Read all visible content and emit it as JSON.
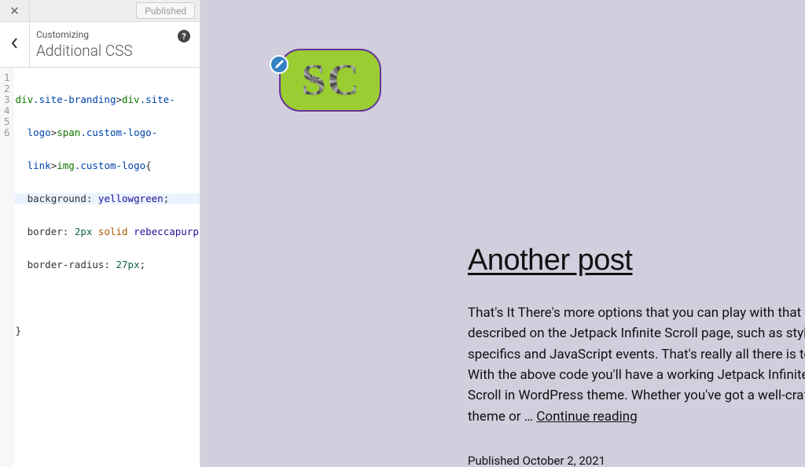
{
  "header": {
    "published_label": "Published"
  },
  "section": {
    "customizing_label": "Customizing",
    "title": "Additional CSS",
    "help_glyph": "?"
  },
  "code": {
    "line_numbers": [
      "1",
      "2",
      "3",
      "4",
      "5",
      "6"
    ],
    "l1_tag1": "div",
    "l1_qual1": ".site-branding",
    "l1_gt1": ">",
    "l1_tag2": "div",
    "l1_qual2": ".site-",
    "l1b_qual": "logo",
    "l1b_gt": ">",
    "l1b_tag": "span",
    "l1b_qual2": ".custom-logo-",
    "l1c_qual": "link",
    "l1c_gt": ">",
    "l1c_tag": "img",
    "l1c_qual2": ".custom-logo",
    "l1c_brace": "{",
    "l2_prop": "background",
    "l2_colon": ": ",
    "l2_val": "yellowgreen",
    "l2_semi": ";",
    "l3_prop": "border",
    "l3_colon": ": ",
    "l3_num": "2px",
    "l3_solid": " solid ",
    "l3_color": "rebeccapurple",
    "l3_semi": ";",
    "l4_prop": "border-radius",
    "l4_colon": ": ",
    "l4_num": "27px",
    "l4_semi": ";",
    "l6_brace": "}"
  },
  "preview": {
    "logo_letters": [
      "S",
      "C"
    ],
    "post_title": "Another post",
    "post_body": "That's It There's more options that you can play with that are described on the Jetpack Infinite Scroll page, such as styling specifics and JavaScript events. That's really all there is to it. With the above code you'll have a working Jetpack Infinite Scroll in WordPress theme. Whether you've got a well-crafted theme or",
    "continue_reading": "Continue reading",
    "meta_prefix": "Published ",
    "meta_date": "October 2, 2021"
  }
}
